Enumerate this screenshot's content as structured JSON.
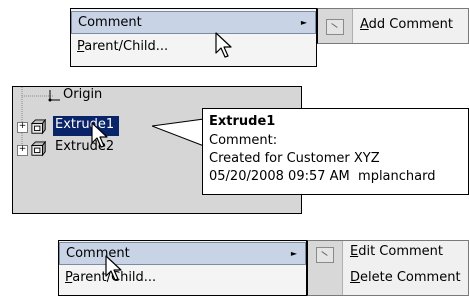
{
  "panel1": {
    "menu": {
      "items": [
        {
          "label": "Comment",
          "has_submenu": true
        },
        {
          "label_u": "P",
          "label_rest": "arent/Child..."
        }
      ]
    },
    "submenu": {
      "items": [
        {
          "label_u": "A",
          "label_rest": "dd Comment",
          "icon": "comment-icon"
        }
      ]
    }
  },
  "panel2": {
    "tree": {
      "origin_label": "Origin",
      "items": [
        {
          "label": "Extrude1",
          "icon": "extrude-feature-icon",
          "selected": true
        },
        {
          "label": "Extrude2",
          "icon": "extrude-feature-icon",
          "selected": false
        }
      ]
    },
    "tooltip": {
      "title": "Extrude1",
      "comment_label": "Comment:",
      "comment_text": "Created for Customer XYZ",
      "timestamp": "05/20/2008 09:57 AM",
      "author": "mplanchard"
    }
  },
  "panel3": {
    "menu": {
      "items": [
        {
          "label": "Comment",
          "has_submenu": true
        },
        {
          "label_u": "P",
          "label_rest": "arent/Child..."
        }
      ]
    },
    "submenu": {
      "items": [
        {
          "label_u": "E",
          "label_rest": "dit Comment"
        },
        {
          "label_u": "D",
          "label_rest": "elete Comment"
        }
      ]
    }
  },
  "colors": {
    "highlight": "#c8d4e6",
    "selection": "#0a246a",
    "panel_gray": "#d6d6d6",
    "menu_bg": "#f4f4f4"
  },
  "glyphs": {
    "submenu_arrow": "►",
    "expand": "+"
  }
}
